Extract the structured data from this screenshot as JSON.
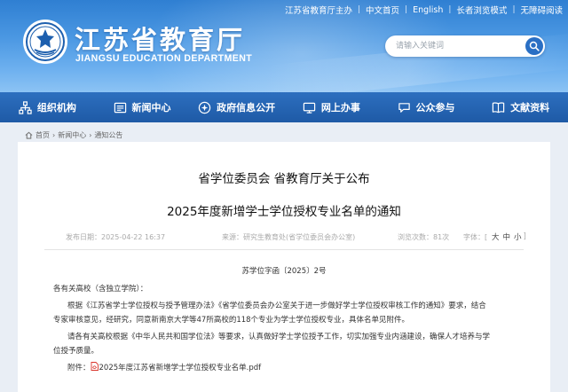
{
  "header": {
    "site_name_cn": "江苏省教育厅",
    "site_name_en": "JIANGSU EDUCATION DEPARTMENT",
    "top_links": [
      "江苏省教育厅主办",
      "中文首页",
      "English",
      "长者浏览模式",
      "无障碍阅读"
    ],
    "search_placeholder": "请输入关键词"
  },
  "nav": {
    "items": [
      {
        "label": "组织机构",
        "icon": "org-chart-icon"
      },
      {
        "label": "新闻中心",
        "icon": "news-icon"
      },
      {
        "label": "政府信息公开",
        "icon": "info-disclosure-icon"
      },
      {
        "label": "网上办事",
        "icon": "online-service-icon"
      },
      {
        "label": "公众参与",
        "icon": "public-participation-icon"
      },
      {
        "label": "文献资料",
        "icon": "documents-icon"
      }
    ]
  },
  "breadcrumb": [
    "首页",
    "新闻中心",
    "通知公告"
  ],
  "article": {
    "title_line1": "省学位委员会 省教育厅关于公布",
    "title_line2": "2025年度新增学士学位授权专业名单的通知",
    "meta": {
      "date": "发布日期：2025-04-22 16:37",
      "source": "来源：研究生教育处(省学位委员会办公室)",
      "views": "浏览次数：81次",
      "font_label": "字体：[",
      "font_large": "大",
      "font_medium": "中",
      "font_small": "小",
      "font_close": "]"
    },
    "doc_number": "苏学位字函〔2025〕2号",
    "salutation": "各有关高校（含独立学院）：",
    "para1_line1": "根据《江苏省学士学位授权与授予管理办法》《省学位委员会办公室关于进一步做好学士学位授权审核工作的通知》要求，结合",
    "para1_line2": "专家审核意见，经研究，同意新南京大学等47所高校的118个专业为学士学位授权专业，具体名单见附件。",
    "para2_line1": "请各有关高校根据《中华人民共和国学位法》等要求，认真做好学士学位授予工作，切实加强专业内涵建设，确保人才培养与学",
    "para2_line2": "位授予质量。",
    "attachment_label": "附件：",
    "attachment_name": "2025年度江苏省新增学士学位授权专业名单.pdf"
  },
  "colors": {
    "header_top": "#2f7fd2",
    "nav_bg": "#1e5aa6",
    "page_bg": "#e9eef5",
    "search_button": "#2a6fc4"
  }
}
